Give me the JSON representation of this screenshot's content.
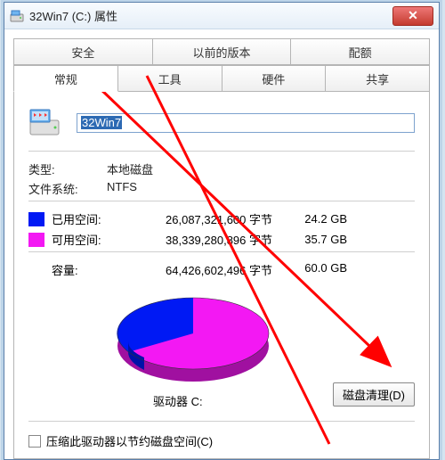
{
  "window": {
    "title": "32Win7  (C:) 属性"
  },
  "tabs": {
    "row1": [
      "安全",
      "以前的版本",
      "配额"
    ],
    "row2": [
      "常规",
      "工具",
      "硬件",
      "共享"
    ],
    "active": "常规"
  },
  "drive": {
    "name": "32Win7"
  },
  "type": {
    "label": "类型:",
    "value": "本地磁盘"
  },
  "fs": {
    "label": "文件系统:",
    "value": "NTFS"
  },
  "used": {
    "label": "已用空间:",
    "bytes": "26,087,321,600 字节",
    "gb": "24.2 GB"
  },
  "free": {
    "label": "可用空间:",
    "bytes": "38,339,280,896 字节",
    "gb": "35.7 GB"
  },
  "capacity": {
    "label": "容量:",
    "bytes": "64,426,602,496 字节",
    "gb": "60.0 GB"
  },
  "driveLabel": "驱动器 C:",
  "cleanBtn": "磁盘清理(D)",
  "compress": "压缩此驱动器以节约磁盘空间(C)",
  "chart_data": {
    "type": "pie",
    "title": "驱动器 C:",
    "series": [
      {
        "name": "已用空间",
        "value": 24.2,
        "color": "#0019f4"
      },
      {
        "name": "可用空间",
        "value": 35.7,
        "color": "#f318f3"
      }
    ],
    "unit": "GB"
  }
}
